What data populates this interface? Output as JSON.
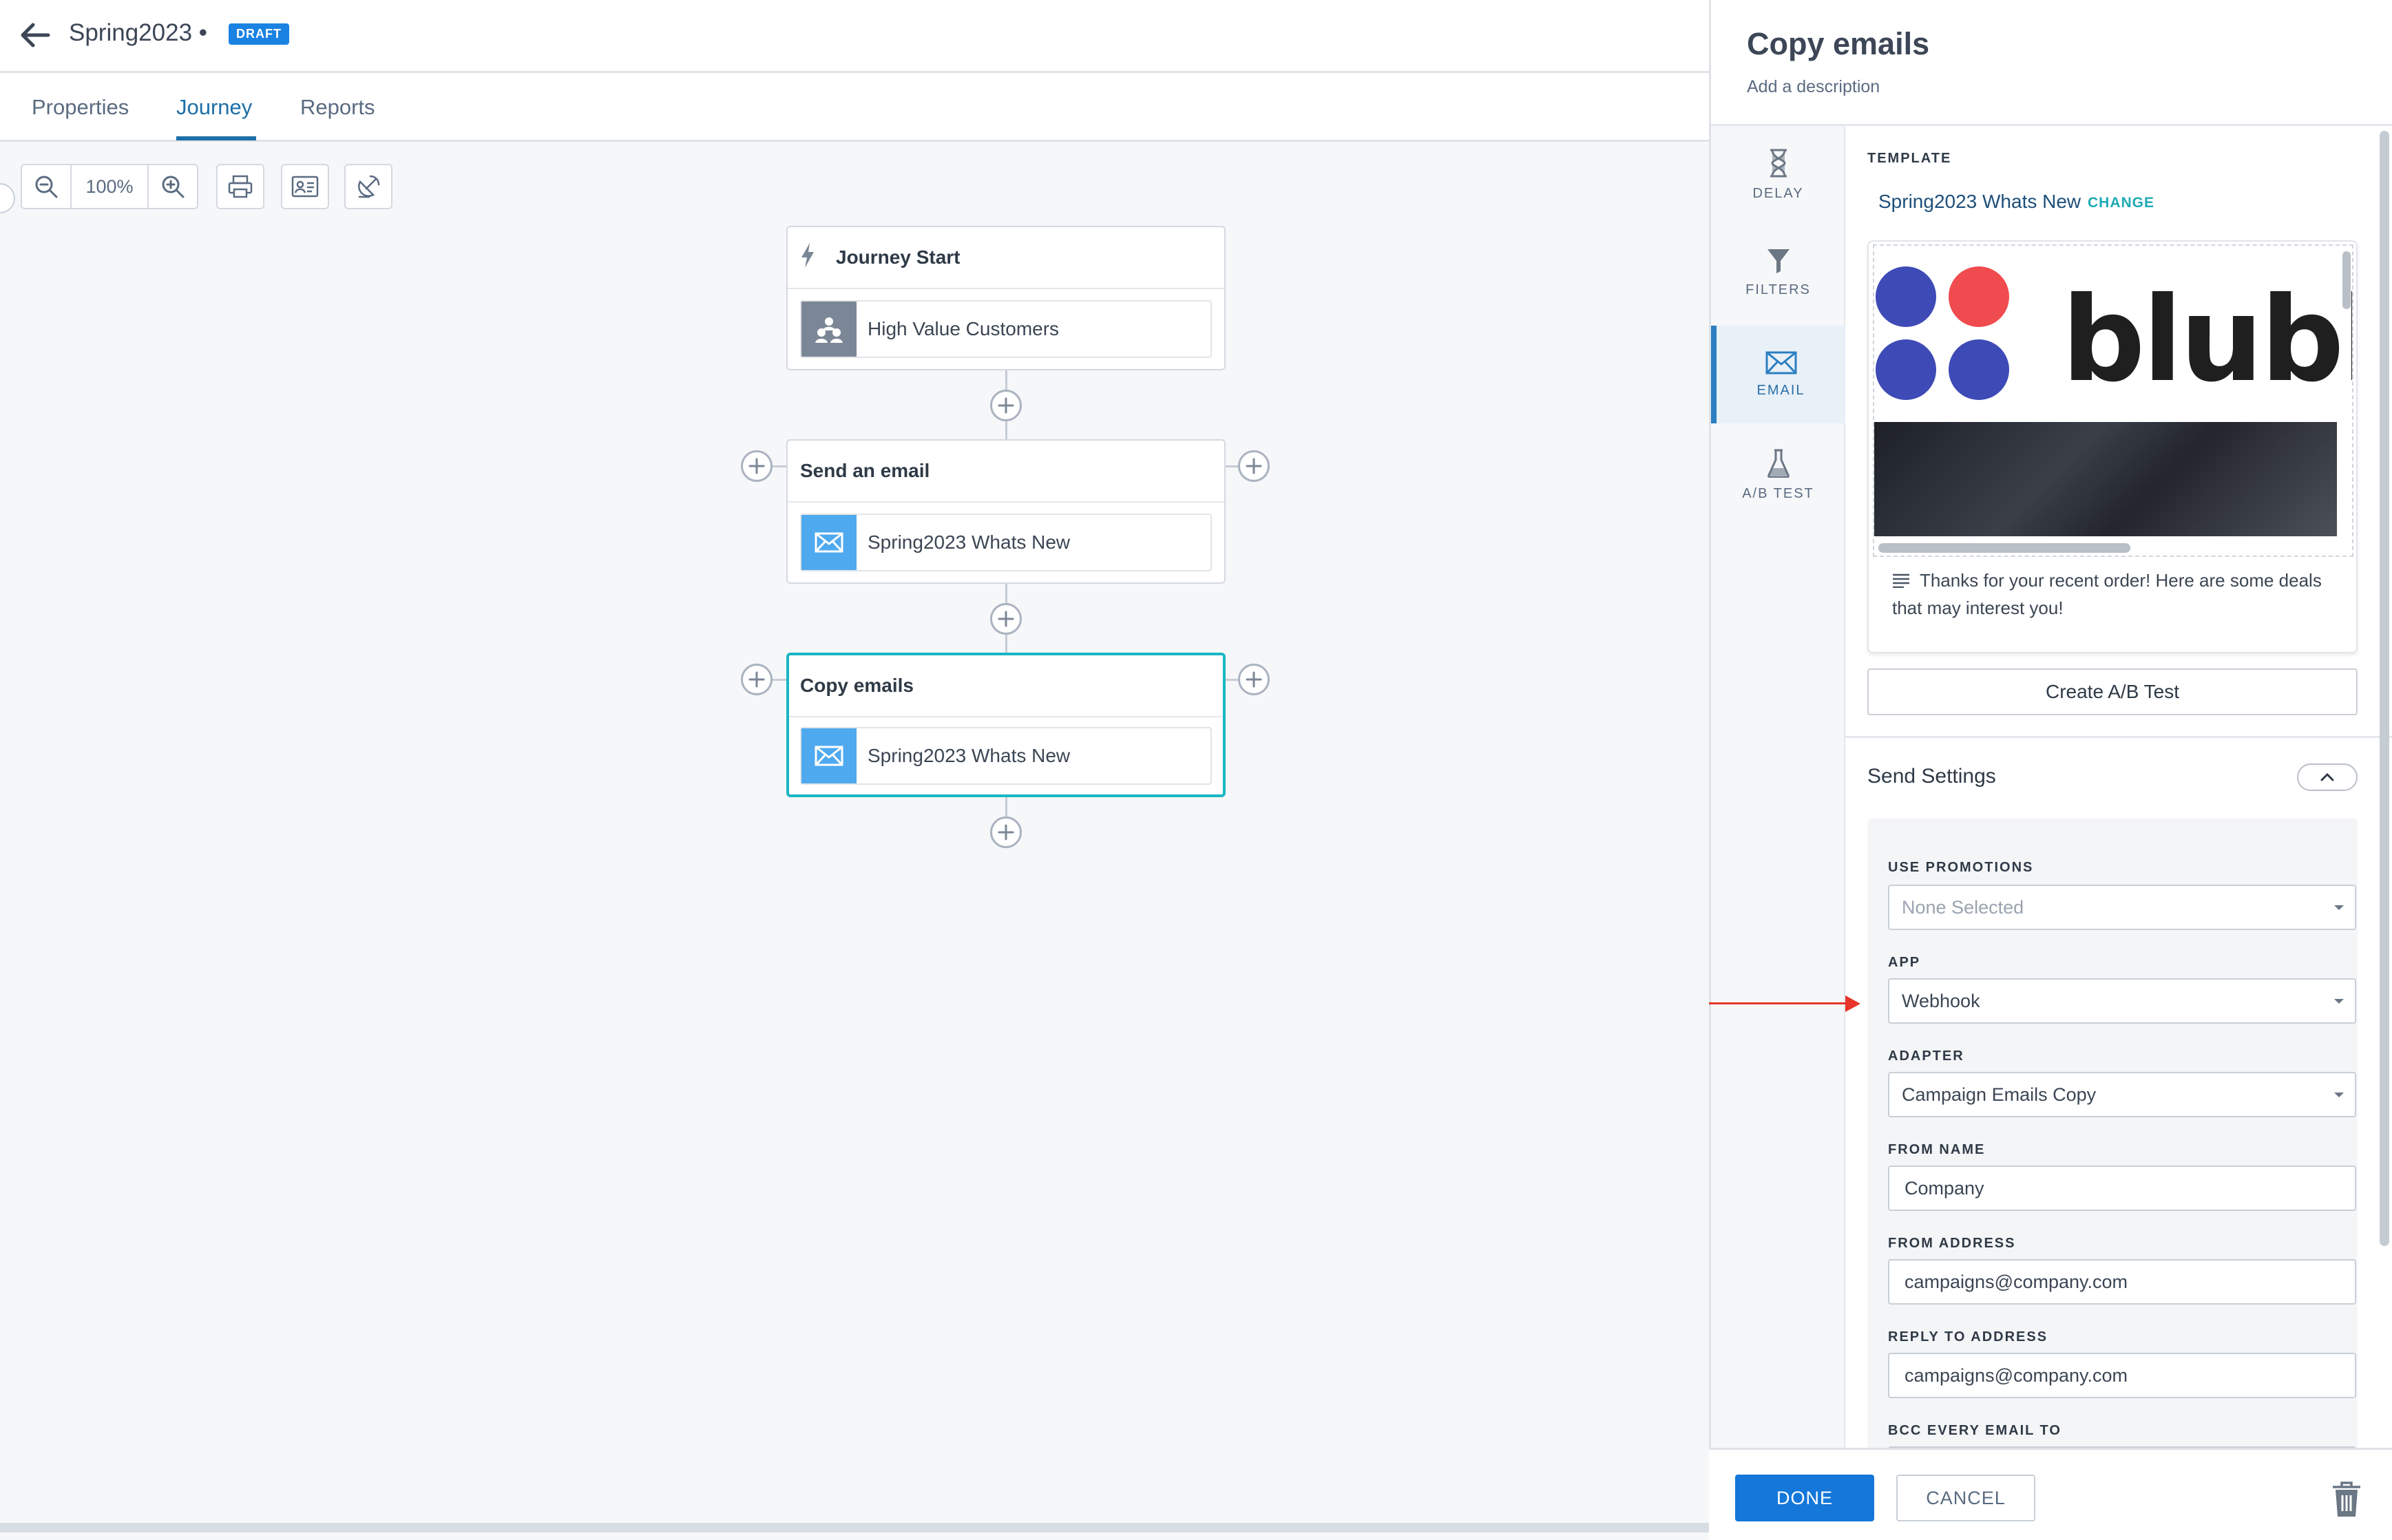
{
  "header": {
    "title": "Spring2023 •",
    "badge": "DRAFT"
  },
  "tabs": [
    {
      "label": "Properties"
    },
    {
      "label": "Journey",
      "active": true
    },
    {
      "label": "Reports"
    }
  ],
  "toolbar": {
    "zoom": "100%"
  },
  "canvas": {
    "start": {
      "title": "Journey Start",
      "segment": "High Value Customers"
    },
    "step1": {
      "title": "Send an email",
      "template": "Spring2023 Whats New"
    },
    "step2": {
      "title": "Copy emails",
      "template": "Spring2023 Whats New",
      "selected": true
    }
  },
  "panel": {
    "title": "Copy emails",
    "description": "Add a description",
    "nav": [
      {
        "label": "DELAY"
      },
      {
        "label": "FILTERS"
      },
      {
        "label": "EMAIL",
        "active": true
      },
      {
        "label": "A/B TEST"
      }
    ],
    "template": {
      "caption": "TEMPLATE",
      "name": "Spring2023 Whats New",
      "change_label": "CHANGE",
      "logo_text": "blubl",
      "preview_text": "Thanks for your recent order! Here are some deals that may interest you!"
    },
    "abtest_button": "Create A/B Test",
    "send_settings": {
      "title": "Send Settings",
      "use_promotions": {
        "label": "USE PROMOTIONS",
        "placeholder": "None Selected"
      },
      "app": {
        "label": "APP",
        "value": "Webhook"
      },
      "adapter": {
        "label": "ADAPTER",
        "value": "Campaign Emails Copy"
      },
      "from_name": {
        "label": "FROM NAME",
        "value": "Company"
      },
      "from_address": {
        "label": "FROM ADDRESS",
        "value": "campaigns@company.com"
      },
      "reply_to": {
        "label": "REPLY TO ADDRESS",
        "value": "campaigns@company.com"
      },
      "bcc": {
        "label": "BCC EVERY EMAIL TO"
      }
    },
    "footer": {
      "done": "DONE",
      "cancel": "CANCEL"
    }
  },
  "colors": {
    "accent": "#1477d9",
    "selected_border": "#19b6c4",
    "logo_blue": "#3e4ab6",
    "logo_red": "#f04b4e",
    "annotation_arrow": "#e8342a"
  }
}
